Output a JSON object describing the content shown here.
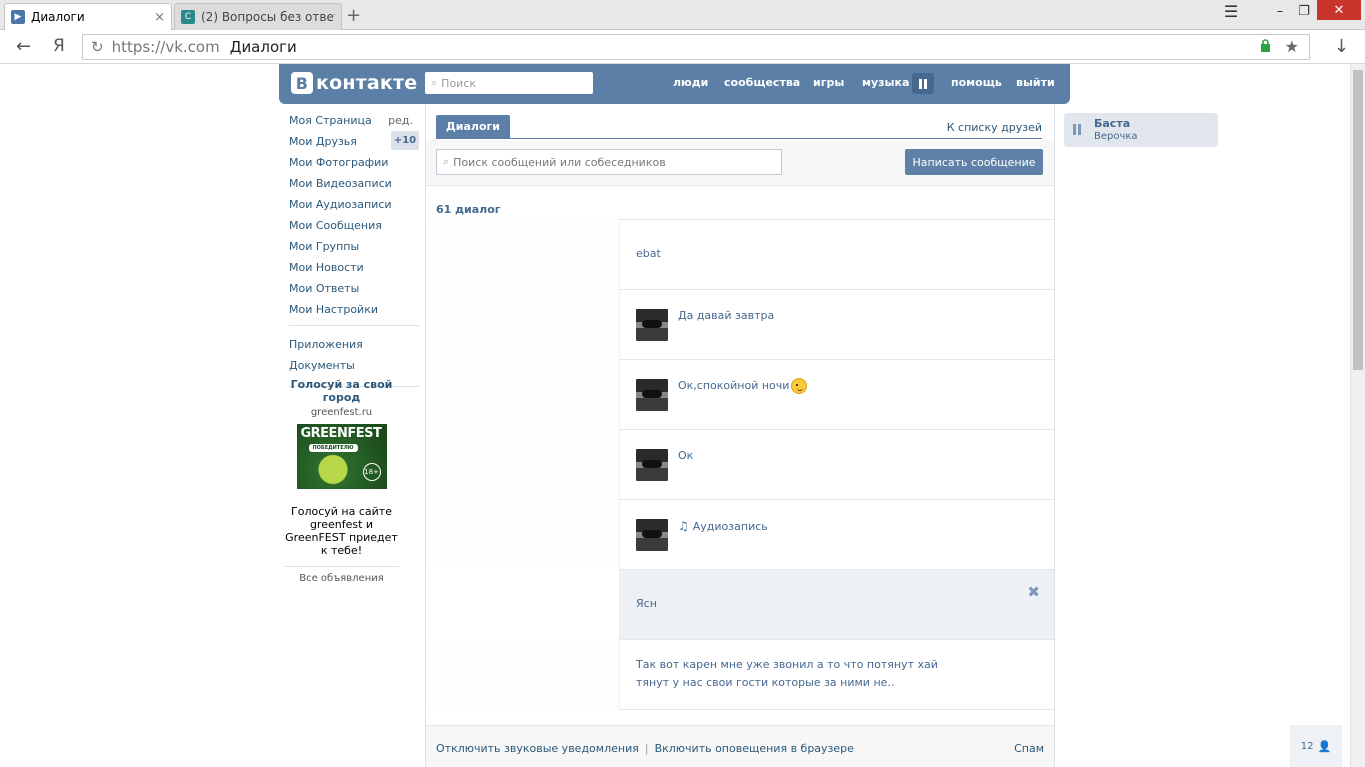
{
  "browser": {
    "tabs": [
      {
        "title": "Диалоги",
        "active": true,
        "favicon_color": "#4a76a8"
      },
      {
        "title": "(2) Вопросы без ответ",
        "active": false,
        "favicon_color": "#2a8a8a"
      }
    ],
    "new_tab": "+",
    "close_tab": "×",
    "url_host": "https://vk.com",
    "url_title": "Диалоги",
    "back_glyph": "←",
    "yandex_glyph": "Я",
    "reload_glyph": "↻",
    "star_glyph": "★",
    "download_glyph": "↓",
    "menu_glyph": "☰",
    "minimize_glyph": "–",
    "restore_glyph": "❐",
    "close_glyph": "✕"
  },
  "vk": {
    "logo_letter": "В",
    "logo_text": "контакте",
    "search_placeholder": "Поиск",
    "nav": {
      "people": "люди",
      "communities": "сообщества",
      "games": "игры",
      "music": "музыка",
      "help": "помощь",
      "logout": "выйти"
    },
    "colors": {
      "brand": "#5b7fa6",
      "link": "#2b587a",
      "accent": "#45688e"
    }
  },
  "left_menu": {
    "items": [
      {
        "label": "Моя Страница",
        "extra": "ред."
      },
      {
        "label": "Мои Друзья",
        "badge": "+10"
      },
      {
        "label": "Мои Фотографии"
      },
      {
        "label": "Мои Видеозаписи"
      },
      {
        "label": "Мои Аудиозаписи"
      },
      {
        "label": "Мои Сообщения"
      },
      {
        "label": "Мои Группы"
      },
      {
        "label": "Мои Новости"
      },
      {
        "label": "Мои Ответы"
      },
      {
        "label": "Мои Настройки"
      }
    ],
    "extra_items": [
      {
        "label": "Приложения"
      },
      {
        "label": "Документы"
      }
    ]
  },
  "ad": {
    "title": "Голосуй за свой город",
    "domain": "greenfest.ru",
    "image_brand": "GREENFEST",
    "image_badge": "ПОБЕДИТЕЛЮ",
    "image_age": "18+",
    "text": "Голосуй на сайте greenfest и GreenFEST приедет к тебе!",
    "all_ads": "Все объявления"
  },
  "messages": {
    "tab_label": "Диалоги",
    "friends_link": "К списку друзей",
    "search_placeholder": "Поиск сообщений или собеседников",
    "write_button": "Написать сообщение",
    "count": "61 диалог",
    "dialogs": [
      {
        "text": "ebat",
        "avatar": false,
        "selected": false
      },
      {
        "text": "Да давай завтра",
        "avatar": true,
        "selected": false
      },
      {
        "text": "Ок,спокойной ночи",
        "avatar": true,
        "selected": false,
        "emoji": true
      },
      {
        "text": "Ок",
        "avatar": true,
        "selected": false
      },
      {
        "text": "Аудиозапись",
        "avatar": true,
        "selected": false,
        "audio": true
      },
      {
        "text": "Ясн",
        "avatar": false,
        "selected": true,
        "delete": "✖"
      },
      {
        "text": "Так вот карен мне уже звонил а то что потянут хай тянут у нас свои гости которые за ними не..",
        "avatar": false,
        "selected": false,
        "long": true
      }
    ],
    "footer": {
      "disable_sounds": "Отключить звуковые уведомления",
      "separator": "|",
      "enable_notifications": "Включить оповещения в браузере",
      "spam": "Спам"
    }
  },
  "player": {
    "artist": "Баста",
    "song": "Верочка"
  },
  "online": {
    "count": "12",
    "icon": "👤"
  }
}
